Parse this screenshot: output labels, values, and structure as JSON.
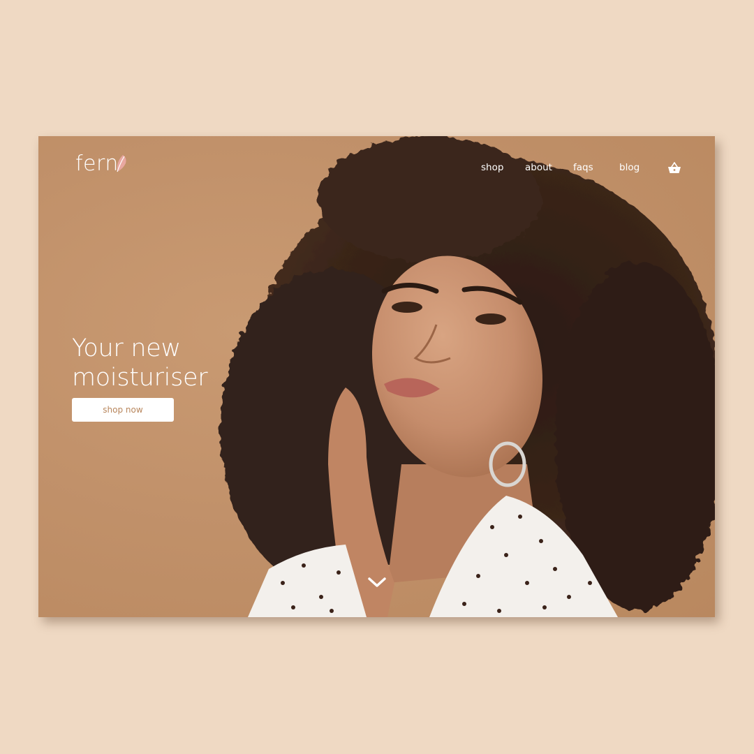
{
  "brand": {
    "name": "fern"
  },
  "nav": {
    "items": [
      {
        "label": "shop"
      },
      {
        "label": "about"
      },
      {
        "label": "faqs"
      },
      {
        "label": "blog"
      }
    ],
    "cart_icon": "basket-icon"
  },
  "hero": {
    "headline_line1": "Your new",
    "headline_line2": "moisturiser",
    "cta_label": "shop now",
    "scroll_icon": "chevron-down-icon",
    "image": "portrait-photo"
  },
  "colors": {
    "page_background": "#efd9c3",
    "hero_background": "#c1916a",
    "accent_text": "#b8865c",
    "foreground": "#ffffff"
  }
}
